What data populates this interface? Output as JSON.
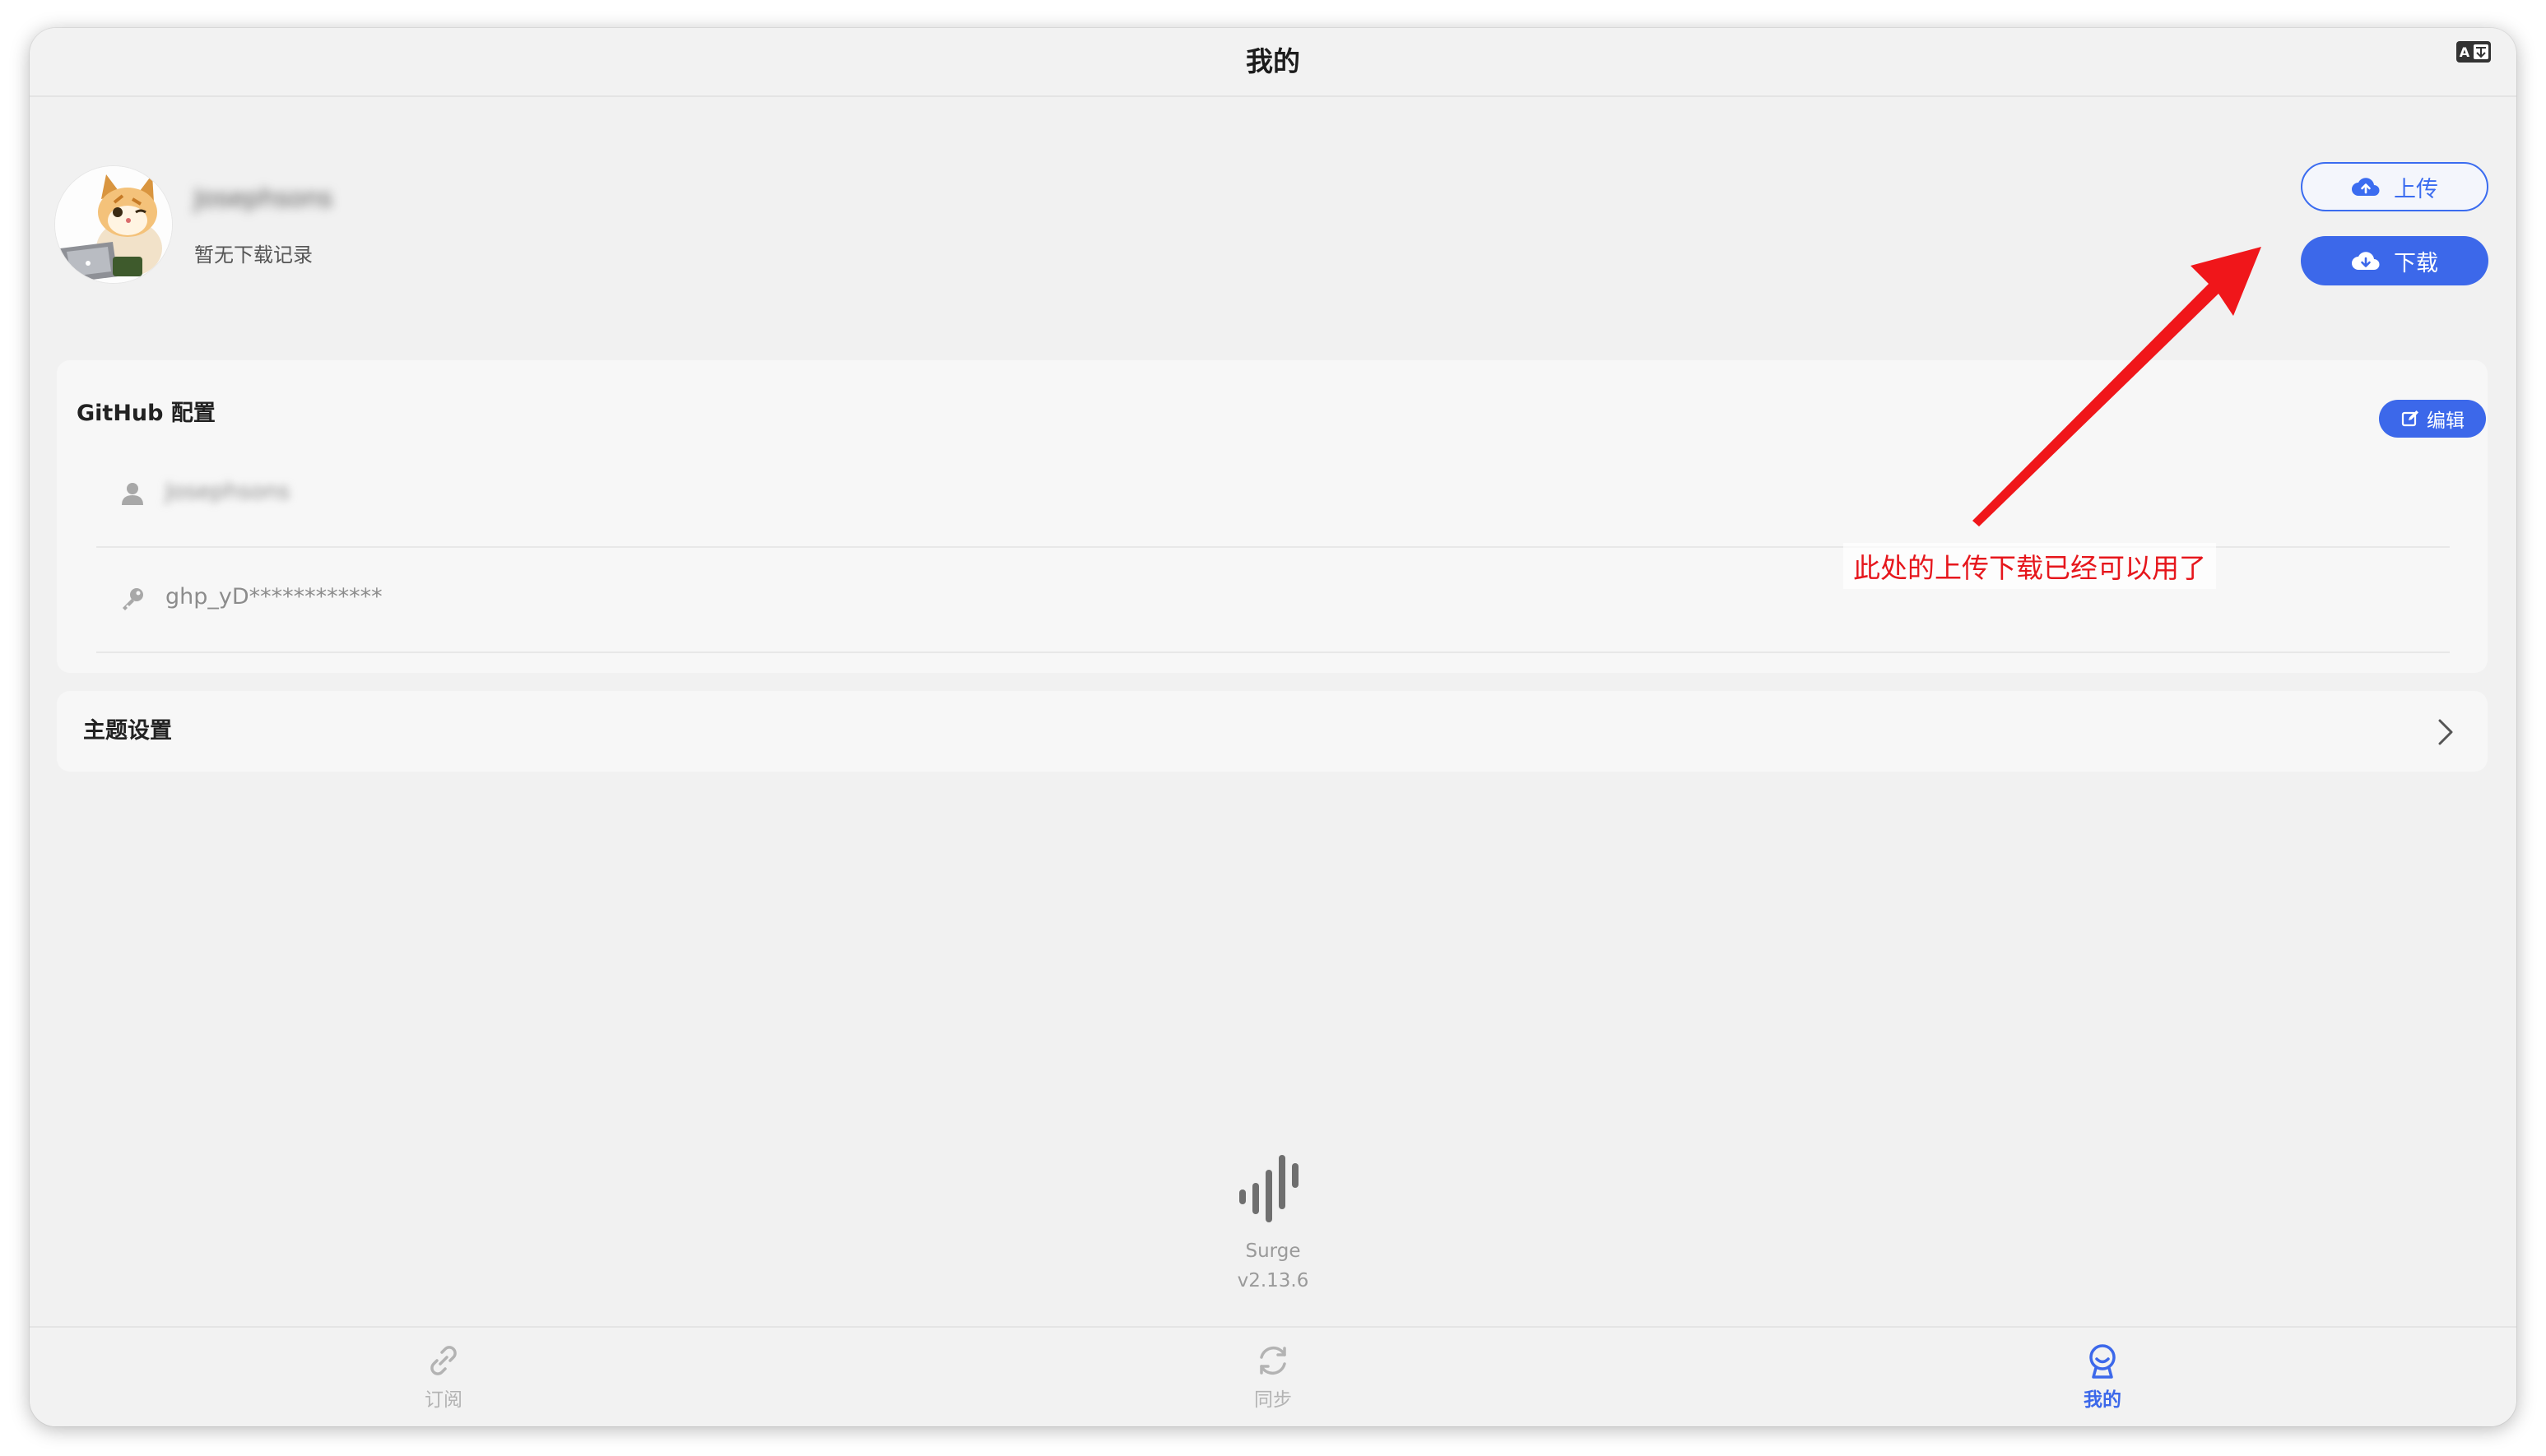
{
  "window": {
    "title": "我的"
  },
  "profile": {
    "username": "Josephsons",
    "download_status": "暂无下载记录"
  },
  "actions": {
    "upload_label": "上传",
    "download_label": "下载"
  },
  "github_config": {
    "title": "GitHub 配置",
    "edit_label": "编辑",
    "username_value": "Josephsons",
    "token_value": "ghp_yD************"
  },
  "theme": {
    "label": "主题设置"
  },
  "app_info": {
    "name": "Surge",
    "version": "v2.13.6"
  },
  "tabbar": {
    "items": [
      {
        "label": "订阅",
        "icon": "link-icon",
        "active": false
      },
      {
        "label": "同步",
        "icon": "sync-icon",
        "active": false
      },
      {
        "label": "我的",
        "icon": "profile-icon",
        "active": true
      }
    ]
  },
  "annotation": {
    "text": "此处的上传下载已经可以用了",
    "color": "#e6161c"
  },
  "colors": {
    "accent": "#3c68ea",
    "inactive": "#b3b3b3",
    "annotation": "#e6161c"
  }
}
